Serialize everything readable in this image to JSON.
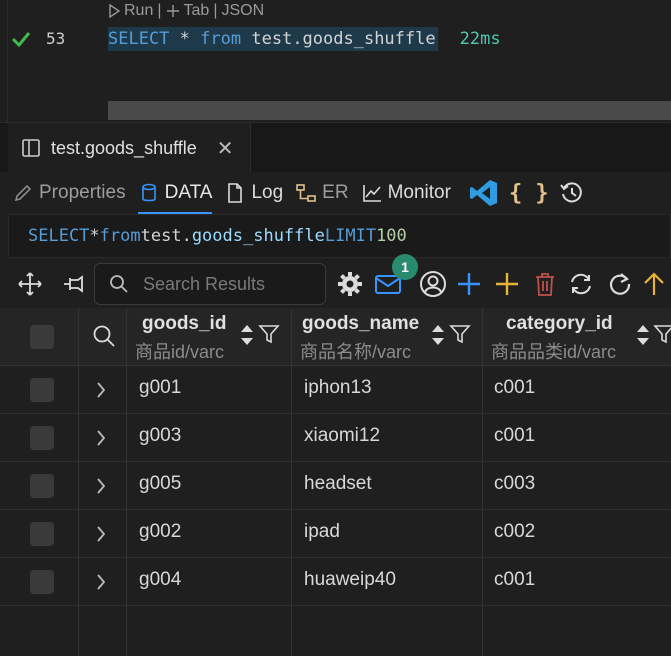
{
  "editor": {
    "codelens": {
      "run": "Run",
      "tab": "Tab",
      "json": "JSON"
    },
    "line_number": "53",
    "query_keyword_select": "SELECT",
    "query_star": "*",
    "query_keyword_from": "from",
    "query_table": "test.goods_shuffle",
    "timing": "22ms"
  },
  "tab": {
    "label": "test.goods_shuffle"
  },
  "subtabs": {
    "properties": "Properties",
    "data": "DATA",
    "log": "Log",
    "er": "ER",
    "monitor": "Monitor",
    "braces": "{ }"
  },
  "querybox": {
    "select": "SELECT",
    "star": "*",
    "from": "from",
    "schema": "test.",
    "table": "goods_shuffle",
    "limit": "LIMIT",
    "limit_value": "100"
  },
  "results_toolbar": {
    "search_placeholder": "Search Results",
    "notification_count": "1"
  },
  "grid": {
    "columns": [
      {
        "name": "goods_id",
        "comment": "商品id/varc"
      },
      {
        "name": "goods_name",
        "comment": "商品名称/varc"
      },
      {
        "name": "category_id",
        "comment": "商品品类id/varc"
      }
    ],
    "rows": [
      {
        "goods_id": "g001",
        "goods_name": "iphon13",
        "category_id": "c001"
      },
      {
        "goods_id": "g003",
        "goods_name": "xiaomi12",
        "category_id": "c001"
      },
      {
        "goods_id": "g005",
        "goods_name": "headset",
        "category_id": "c003"
      },
      {
        "goods_id": "g002",
        "goods_name": "ipad",
        "category_id": "c002"
      },
      {
        "goods_id": "g004",
        "goods_name": "huaweip40",
        "category_id": "c001"
      }
    ]
  },
  "colors": {
    "keyword": "#569cd6",
    "timing": "#4ec9b0",
    "accent": "#3794ff",
    "badge": "#2a8a6e",
    "add_blue": "#3794ff",
    "add_yellow": "#e8b339",
    "delete_red": "#c0504d"
  }
}
